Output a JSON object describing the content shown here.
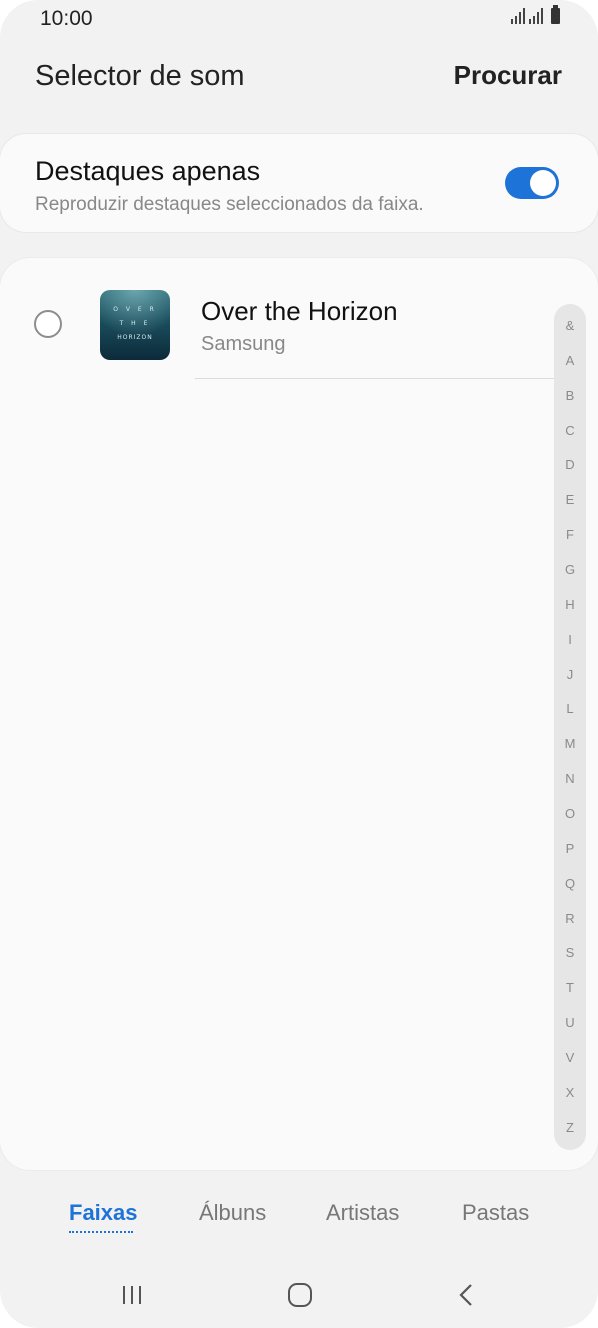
{
  "status_bar": {
    "time": "10:00",
    "icons": [
      "signal-icon",
      "signal-icon",
      "battery-icon"
    ]
  },
  "app_bar": {
    "title": "Selector de som",
    "search_label": "Procurar"
  },
  "highlights": {
    "title": "Destaques apenas",
    "subtitle": "Reproduzir destaques seleccionados da faixa.",
    "toggle_on": true,
    "accent_color": "#1e73d8"
  },
  "tracks": [
    {
      "title": "Over the Horizon",
      "artist": "Samsung",
      "selected": false,
      "cover_text": [
        "O V E R",
        "T H E",
        "HORIZON"
      ]
    }
  ],
  "index_letters": [
    "&",
    "A",
    "B",
    "C",
    "D",
    "E",
    "F",
    "G",
    "H",
    "I",
    "J",
    "L",
    "M",
    "N",
    "O",
    "P",
    "Q",
    "R",
    "S",
    "T",
    "U",
    "V",
    "X",
    "Z"
  ],
  "tabs": [
    {
      "label": "Faixas",
      "active": true
    },
    {
      "label": "Álbuns",
      "active": false
    },
    {
      "label": "Artistas",
      "active": false
    },
    {
      "label": "Pastas",
      "active": false
    }
  ],
  "nav": [
    "recent-apps-icon",
    "home-icon",
    "back-icon"
  ]
}
